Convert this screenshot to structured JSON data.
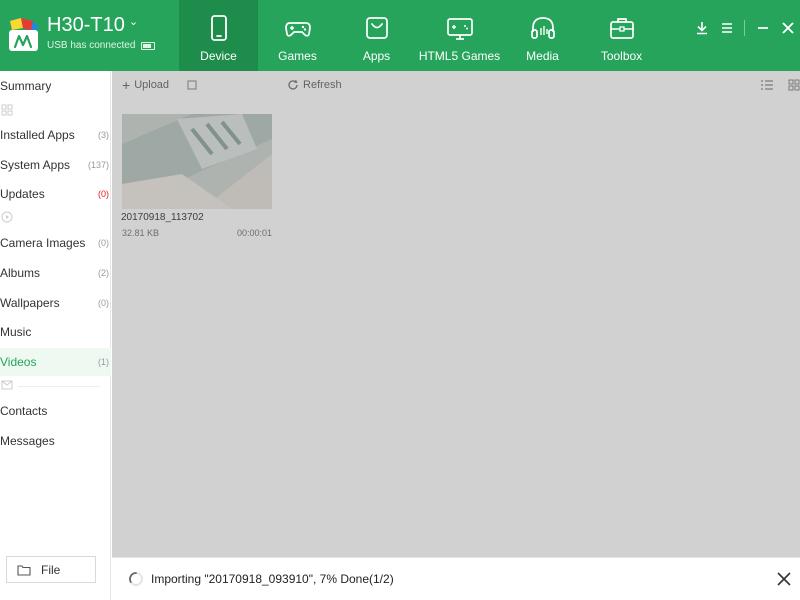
{
  "header": {
    "device_name": "H30-T10",
    "status": "USB has connected",
    "accent": "#26a45b",
    "tabs": [
      {
        "label": "Device",
        "icon": "tablet-icon",
        "active": true
      },
      {
        "label": "Games",
        "icon": "gamepad-icon"
      },
      {
        "label": "Apps",
        "icon": "shopping-bag-icon"
      },
      {
        "label": "HTML5 Games",
        "icon": "html5-game-icon"
      },
      {
        "label": "Media",
        "icon": "headphones-icon"
      },
      {
        "label": "Toolbox",
        "icon": "toolbox-icon"
      }
    ]
  },
  "sidebar": {
    "items": [
      {
        "label": "Summary",
        "count": ""
      },
      {
        "label": "Installed Apps",
        "count": "(3)"
      },
      {
        "label": "System Apps",
        "count": "(137)"
      },
      {
        "label": "Updates",
        "count": "(0)"
      },
      {
        "label": "Camera Images",
        "count": "(0)"
      },
      {
        "label": "Albums",
        "count": "(2)"
      },
      {
        "label": "Wallpapers",
        "count": "(0)"
      },
      {
        "label": "Music",
        "count": ""
      },
      {
        "label": "Videos",
        "count": "(1)",
        "active": true
      },
      {
        "label": "Contacts",
        "count": ""
      },
      {
        "label": "Messages",
        "count": ""
      }
    ],
    "file_button": "File"
  },
  "toolbar": {
    "upload": "Upload",
    "refresh": "Refresh"
  },
  "videos": [
    {
      "name": "20170918_113702",
      "size": "32.81 KB",
      "duration": "00:00:01"
    }
  ],
  "status_bar": {
    "text": "Importing \"20170918_093910\", 7% Done(1/2)",
    "progress_percent": 7
  }
}
